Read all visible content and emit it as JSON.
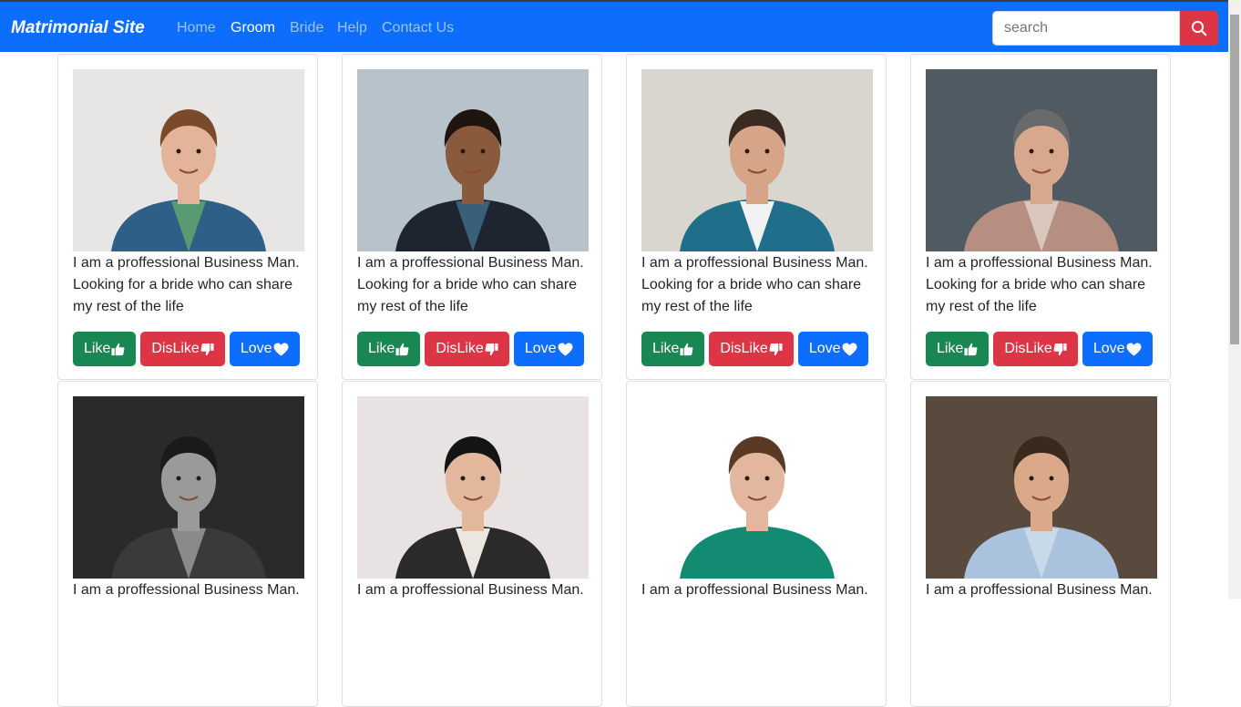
{
  "navbar": {
    "brand": "Matrimonial Site",
    "links": [
      {
        "label": "Home",
        "active": false
      },
      {
        "label": "Groom",
        "active": true
      },
      {
        "label": "Bride",
        "active": false
      },
      {
        "label": "Help",
        "active": false
      },
      {
        "label": "Contact Us",
        "active": false
      }
    ],
    "search_placeholder": "search",
    "search_icon": "search-icon"
  },
  "buttons": {
    "like": "Like",
    "dislike": "DisLike",
    "love": "Love",
    "like_icon": "thumbs-up-icon",
    "dislike_icon": "thumbs-down-icon",
    "love_icon": "heart-icon"
  },
  "cards": [
    {
      "description": "I am a proffessional Business Man. Looking for a bride who can share my rest of the life"
    },
    {
      "description": "I am a proffessional Business Man. Looking for a bride who can share my rest of the life"
    },
    {
      "description": "I am a proffessional Business Man. Looking for a bride who can share my rest of the life"
    },
    {
      "description": "I am a proffessional Business Man. Looking for a bride who can share my rest of the life"
    },
    {
      "description": "I am a proffessional Business Man."
    },
    {
      "description": "I am a proffessional Business Man."
    },
    {
      "description": "I am a proffessional Business Man."
    },
    {
      "description": "I am a proffessional Business Man."
    }
  ],
  "colors": {
    "navbar": "#0d6efd",
    "like": "#198754",
    "dislike": "#dc3545",
    "love": "#0d6efd"
  }
}
